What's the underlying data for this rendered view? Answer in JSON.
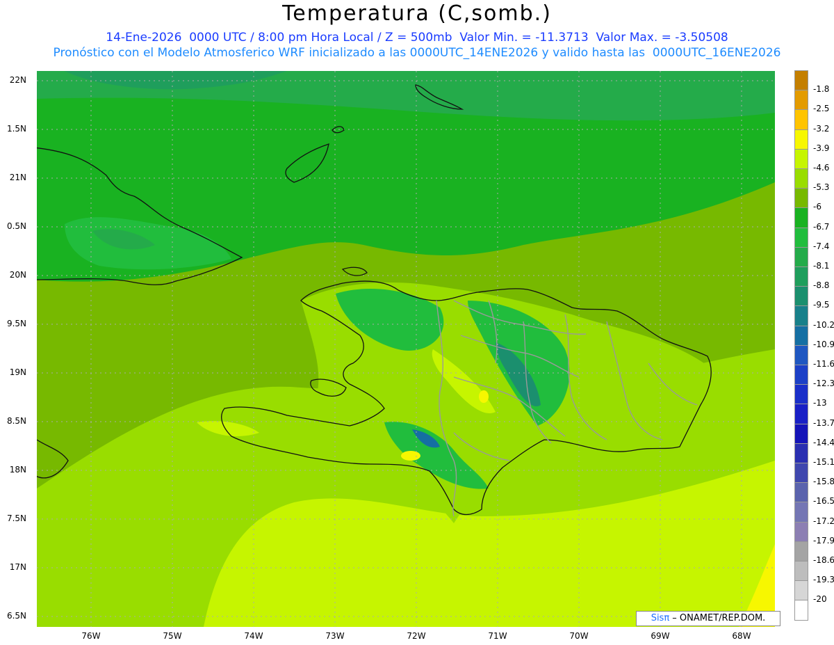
{
  "header": {
    "title": "Temperatura (C,somb.)",
    "subtitle_1": "14-Ene-2026  0000 UTC / 8:00 pm Hora Local / Z = 500mb  Valor Min. = -11.3713  Valor Max. = -3.50508",
    "subtitle_2": "Pronóstico con el Modelo Atmosferico WRF inicializado a las 0000UTC_14ENE2026 y valido hasta las  0000UTC_16ENE2026"
  },
  "axes": {
    "lat_labels": [
      "22N",
      "1.5N",
      "21N",
      "0.5N",
      "20N",
      "9.5N",
      "19N",
      "8.5N",
      "18N",
      "7.5N",
      "17N",
      "6.5N"
    ],
    "lon_labels": [
      "76W",
      "75W",
      "74W",
      "73W",
      "72W",
      "71W",
      "70W",
      "69W",
      "68W"
    ]
  },
  "colorbar": {
    "labels": [
      "-1.8",
      "-2.5",
      "-3.2",
      "-3.9",
      "-4.6",
      "-5.3",
      "-6",
      "-6.7",
      "-7.4",
      "-8.1",
      "-8.8",
      "-9.5",
      "-10.2",
      "-10.9",
      "-11.6",
      "-12.3",
      "-13",
      "-13.7",
      "-14.4",
      "-15.1",
      "-15.8",
      "-16.5",
      "-17.2",
      "-17.9",
      "-18.6",
      "-19.3",
      "-20"
    ],
    "colors": [
      "#c47f00",
      "#e39b00",
      "#ffc400",
      "#f7f700",
      "#c6f500",
      "#99dd00",
      "#77b900",
      "#19b221",
      "#21bd3d",
      "#24ab4a",
      "#1f9e5c",
      "#1b8f6e",
      "#18808a",
      "#156fa3",
      "#1f57c1",
      "#1c40c7",
      "#1a2fc9",
      "#1920c6",
      "#1514b8",
      "#2a2fb1",
      "#3f47ae",
      "#5a63ad",
      "#7476b4",
      "#8c7fb3",
      "#a4a4a4",
      "#bdbdbd",
      "#d6d6d6",
      "#ffffff"
    ]
  },
  "credit": {
    "sis": "Sisπ",
    "rest": " – ONAMET/REP.DOM."
  }
}
